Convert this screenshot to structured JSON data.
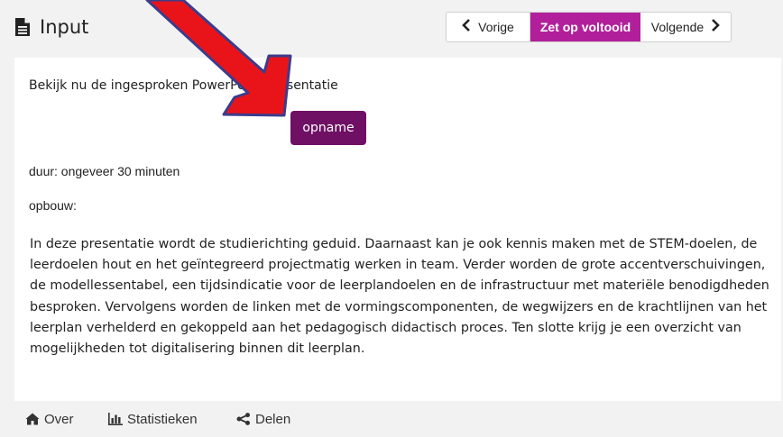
{
  "header": {
    "title": "Input",
    "nav": {
      "prev_label": "Vorige",
      "done_label": "Zet op voltooid",
      "next_label": "Volgende"
    }
  },
  "content": {
    "intro": "Bekijk nu de ingesproken PowerPoint-presentatie",
    "recording_button": "opname",
    "duration": "duur: ongeveer 30 minuten",
    "structure_label": "opbouw:",
    "paragraph": "In deze presentatie wordt de studierichting geduid. Daarnaast kan je ook kennis maken met de STEM-doelen, de leerdoelen hout en het geïntegreerd projectmatig werken in team. Verder worden de grote accentverschuivingen, de modellessentabel, een tijdsindicatie voor de leerplandoelen en de infrastructuur met materiële benodigdheden besproken. Vervolgens worden de linken met de vormingscomponenten, de wegwijzers en de krachtlijnen van het leerplan verhelderd en gekoppeld aan het pedagogisch didactisch proces. Ten slotte krijg je een overzicht van mogelijkheden tot digitalisering binnen dit leerplan."
  },
  "footer": {
    "over_label": "Over",
    "stats_label": "Statistieken",
    "share_label": "Delen"
  },
  "colors": {
    "accent": "#b21f9b",
    "button": "#6f1064",
    "annotation_arrow": "#e8141a"
  },
  "icons": [
    "document-icon",
    "chevron-left-icon",
    "chevron-right-icon",
    "home-icon",
    "bar-chart-icon",
    "share-icon"
  ]
}
